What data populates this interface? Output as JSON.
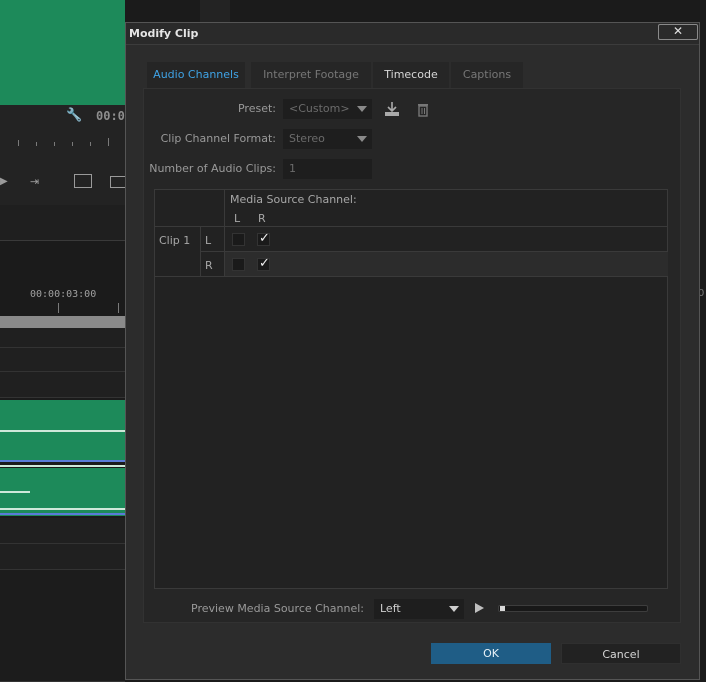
{
  "background": {
    "timecode_partial": "00:0",
    "timeline_time": "00:00:03:00",
    "edge_text": "0"
  },
  "dialog": {
    "title": "Modify Clip",
    "close_label": "✕",
    "tabs": [
      {
        "label": "Audio Channels",
        "active": true
      },
      {
        "label": "Interpret Footage",
        "active": false
      },
      {
        "label": "Timecode",
        "active": false
      },
      {
        "label": "Captions",
        "active": false
      }
    ],
    "preset": {
      "label": "Preset:",
      "value": "<Custom>",
      "save_icon": "save-preset-icon",
      "delete_icon": "trash-icon"
    },
    "channel_format": {
      "label": "Clip Channel Format:",
      "value": "Stereo"
    },
    "num_clips": {
      "label": "Number of Audio Clips:",
      "value": "1"
    },
    "grid": {
      "header": "Media Source Channel:",
      "columns": [
        "L",
        "R"
      ],
      "clip_label": "Clip 1",
      "rows": [
        {
          "channel": "L",
          "checks": [
            false,
            true
          ]
        },
        {
          "channel": "R",
          "checks": [
            false,
            true
          ]
        }
      ]
    },
    "preview": {
      "label": "Preview Media Source Channel:",
      "value": "Left",
      "progress": 0.0
    },
    "buttons": {
      "ok": "OK",
      "cancel": "Cancel"
    },
    "colors": {
      "accent_tab": "#3fa3e6",
      "ok_button": "#1f5d86",
      "clip_green": "#1d8a5a"
    }
  }
}
